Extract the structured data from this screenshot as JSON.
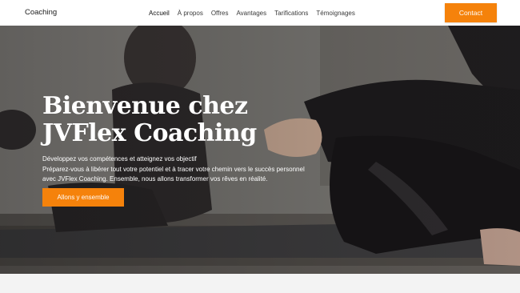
{
  "header": {
    "brand": "Coaching",
    "nav": [
      {
        "label": "Accueil"
      },
      {
        "label": "À propos"
      },
      {
        "label": "Offres"
      },
      {
        "label": "Avantages"
      },
      {
        "label": "Tarifications"
      },
      {
        "label": "Témoignages"
      }
    ],
    "contact_label": "Contact"
  },
  "hero": {
    "title": "Bienvenue chez JVFlex Coaching",
    "subtitle": "Développez vos compétences et atteignez vos objectif",
    "description": "Préparez-vous à libérer tout votre potentiel et à tracer votre chemin vers le succès personnel avec JVFlex Coaching. Ensemble, nous allons transformer vos rêves en réalité.",
    "cta_label": "Allons y ensemble"
  },
  "colors": {
    "accent": "#f5820b"
  }
}
